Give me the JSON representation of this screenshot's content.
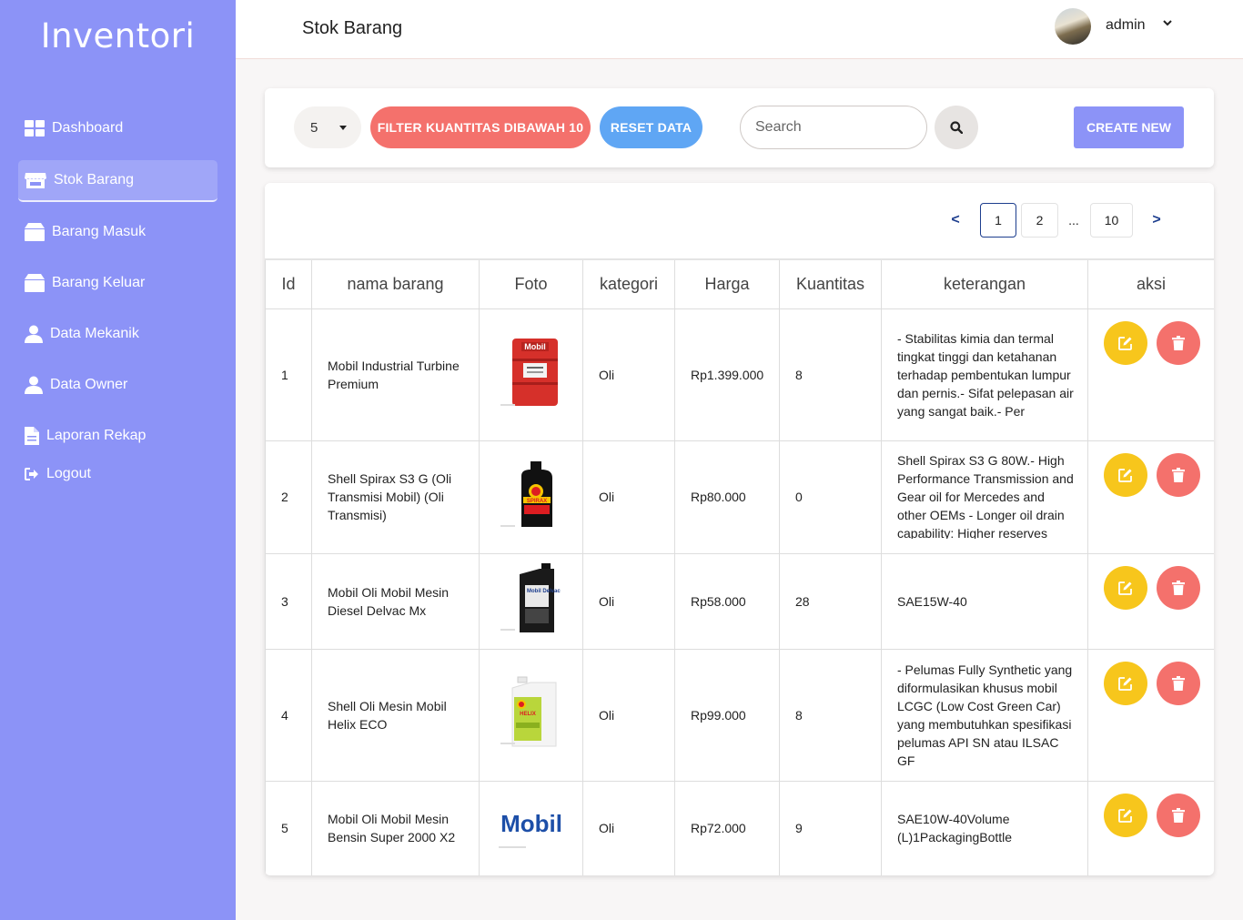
{
  "sidebar": {
    "brand": "Inventori",
    "items": [
      {
        "label": "Dashboard",
        "icon": "dashboard-icon"
      },
      {
        "label": "Stok Barang",
        "icon": "store-icon",
        "active": true
      },
      {
        "label": "Barang Masuk",
        "icon": "box-icon"
      },
      {
        "label": "Barang Keluar",
        "icon": "box-icon"
      },
      {
        "label": "Data Mekanik",
        "icon": "user-icon"
      },
      {
        "label": "Data Owner",
        "icon": "user-icon"
      },
      {
        "label": "Laporan Rekap",
        "icon": "file-icon"
      },
      {
        "label": "Logout",
        "icon": "logout-icon"
      }
    ]
  },
  "header": {
    "title": "Stok Barang",
    "user": "admin"
  },
  "toolbar": {
    "per_page": "5",
    "filter_label": "FILTER KUANTITAS DIBAWAH 10",
    "reset_label": "RESET DATA",
    "search_placeholder": "Search",
    "create_label": "CREATE NEW"
  },
  "pagination": {
    "prev": "<",
    "pages": [
      "1",
      "2",
      "...",
      "10"
    ],
    "current": "1",
    "next": ">"
  },
  "table": {
    "columns": [
      "Id",
      "nama barang",
      "Foto",
      "kategori",
      "Harga",
      "Kuantitas",
      "keterangan",
      "aksi"
    ],
    "rows": [
      {
        "id": "1",
        "nama": "Mobil Industrial Turbine Premium",
        "foto": "mobil-drum",
        "kategori": "Oli",
        "harga": "Rp1.399.000",
        "kuantitas": "8",
        "keterangan": "- Stabilitas kimia dan termal tingkat tinggi dan ketahanan terhadap pembentukan lumpur dan pernis.- Sifat pelepasan air yang sangat baik.- Per"
      },
      {
        "id": "2",
        "nama": "Shell Spirax S3 G (Oli Transmisi Mobil) (Oli Transmisi)",
        "foto": "shell-spirax-bottle",
        "kategori": "Oli",
        "harga": "Rp80.000",
        "kuantitas": "0",
        "keterangan": "Shell Spirax S3 G 80W.- High Performance Transmission and Gear oil for Mercedes and other OEMs - Longer oil drain capability: Higher reserves"
      },
      {
        "id": "3",
        "nama": "Mobil Oli Mobil Mesin Diesel Delvac Mx",
        "foto": "mobil-delvac-jug",
        "kategori": "Oli",
        "harga": "Rp58.000",
        "kuantitas": "28",
        "keterangan": "SAE15W-40"
      },
      {
        "id": "4",
        "nama": "Shell Oli Mesin Mobil Helix ECO",
        "foto": "shell-helix-jug",
        "kategori": "Oli",
        "harga": "Rp99.000",
        "kuantitas": "8",
        "keterangan": "- Pelumas Fully Synthetic yang diformulasikan khusus mobil LCGC (Low Cost Green Car) yang membutuhkan spesifikasi pelumas API SN atau ILSAC GF"
      },
      {
        "id": "5",
        "nama": "Mobil Oli Mobil Mesin Bensin Super 2000 X2",
        "foto": "mobil-logo",
        "kategori": "Oli",
        "harga": "Rp72.000",
        "kuantitas": "9",
        "keterangan": "SAE10W-40Volume (L)1PackagingBottle"
      }
    ]
  },
  "product_images": {
    "mobil_drum_label": "Mobil",
    "mobil_logo_text": "Mobil",
    "spirax_label": "SPIRAX",
    "delvac_label": "Mobil Delvac",
    "helix_label": "HELIX"
  },
  "colors": {
    "sidebar": "#8c93f7",
    "filter_button": "#f4716c",
    "reset_button": "#5fa6f4",
    "create_button": "#8c93f7",
    "edit_button": "#f7c61c",
    "delete_button": "#f4716c"
  }
}
